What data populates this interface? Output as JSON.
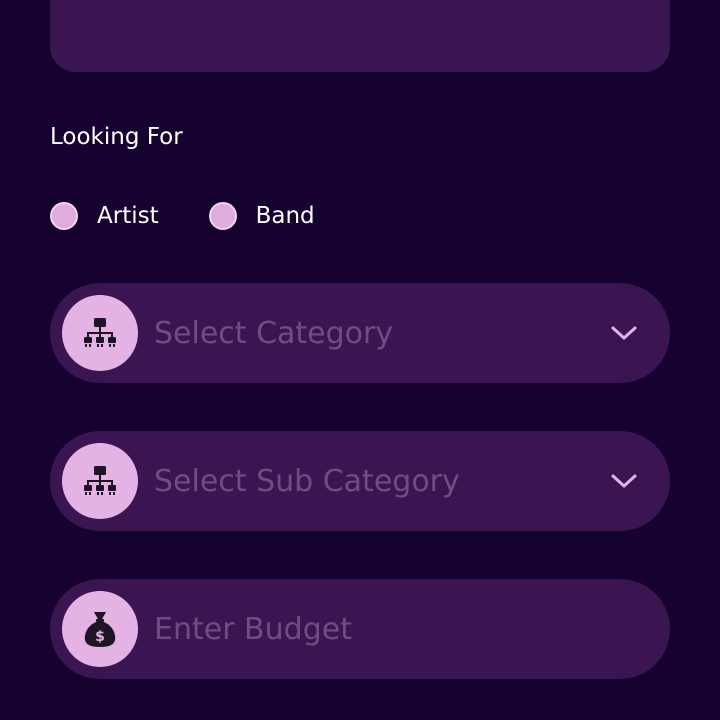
{
  "looking_for": {
    "label": "Looking For",
    "options": [
      {
        "label": "Artist",
        "selected": false
      },
      {
        "label": "Band",
        "selected": false
      }
    ]
  },
  "category": {
    "placeholder": "Select Category",
    "icon": "sitemap-icon"
  },
  "sub_category": {
    "placeholder": "Select Sub Category",
    "icon": "sitemap-icon"
  },
  "budget": {
    "placeholder": "Enter Budget",
    "icon": "money-bag-icon"
  },
  "colors": {
    "background": "#160230",
    "card": "#3a1551",
    "accent": "#e4b2e3",
    "placeholder_text": "#6e4d80"
  }
}
